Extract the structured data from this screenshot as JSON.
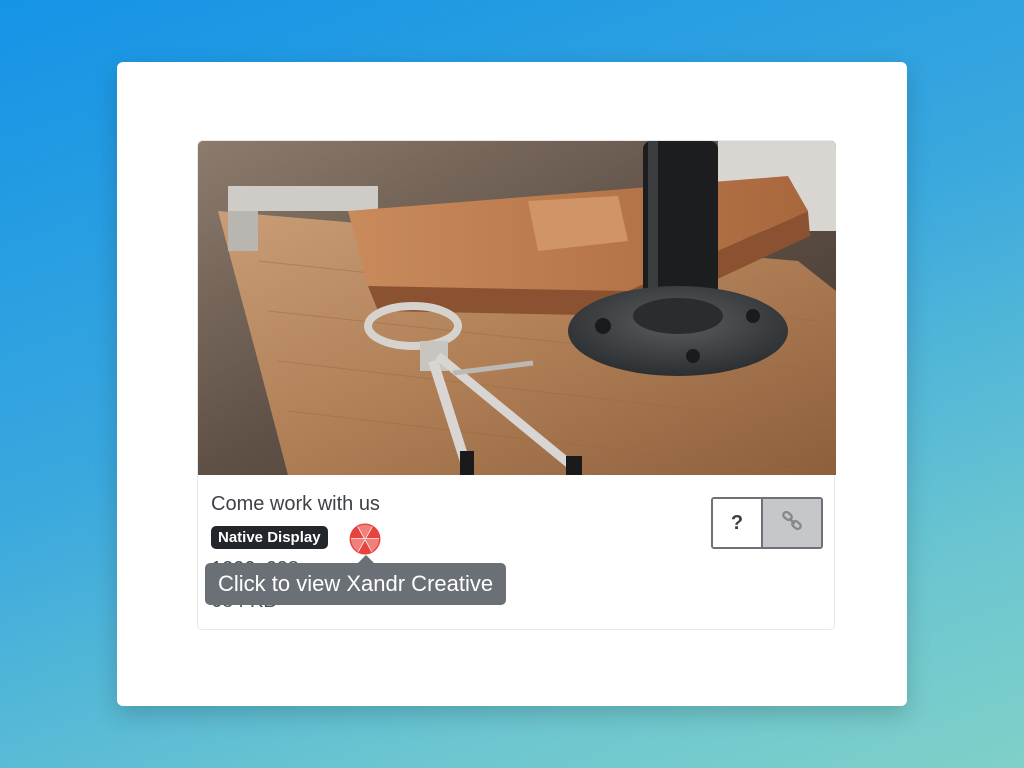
{
  "creative": {
    "headline": "Come work with us",
    "format_badge": "Native Display",
    "dimensions": "1200x628",
    "file_size": "684 KB",
    "image_alt": "Workbench with compass, leather folio and pipe flange"
  },
  "tooltip": {
    "text": "Click to view Xandr Creative"
  },
  "actions": {
    "help_label": "?",
    "link_icon": "link-icon"
  },
  "icons": {
    "xandr": "xandr-logo-icon"
  },
  "colors": {
    "badge_bg": "#23272b",
    "tooltip_bg": "#6b7077",
    "xandr_red": "#e8433f",
    "background_top": "#1593e6",
    "background_bottom": "#7fd0c8"
  }
}
